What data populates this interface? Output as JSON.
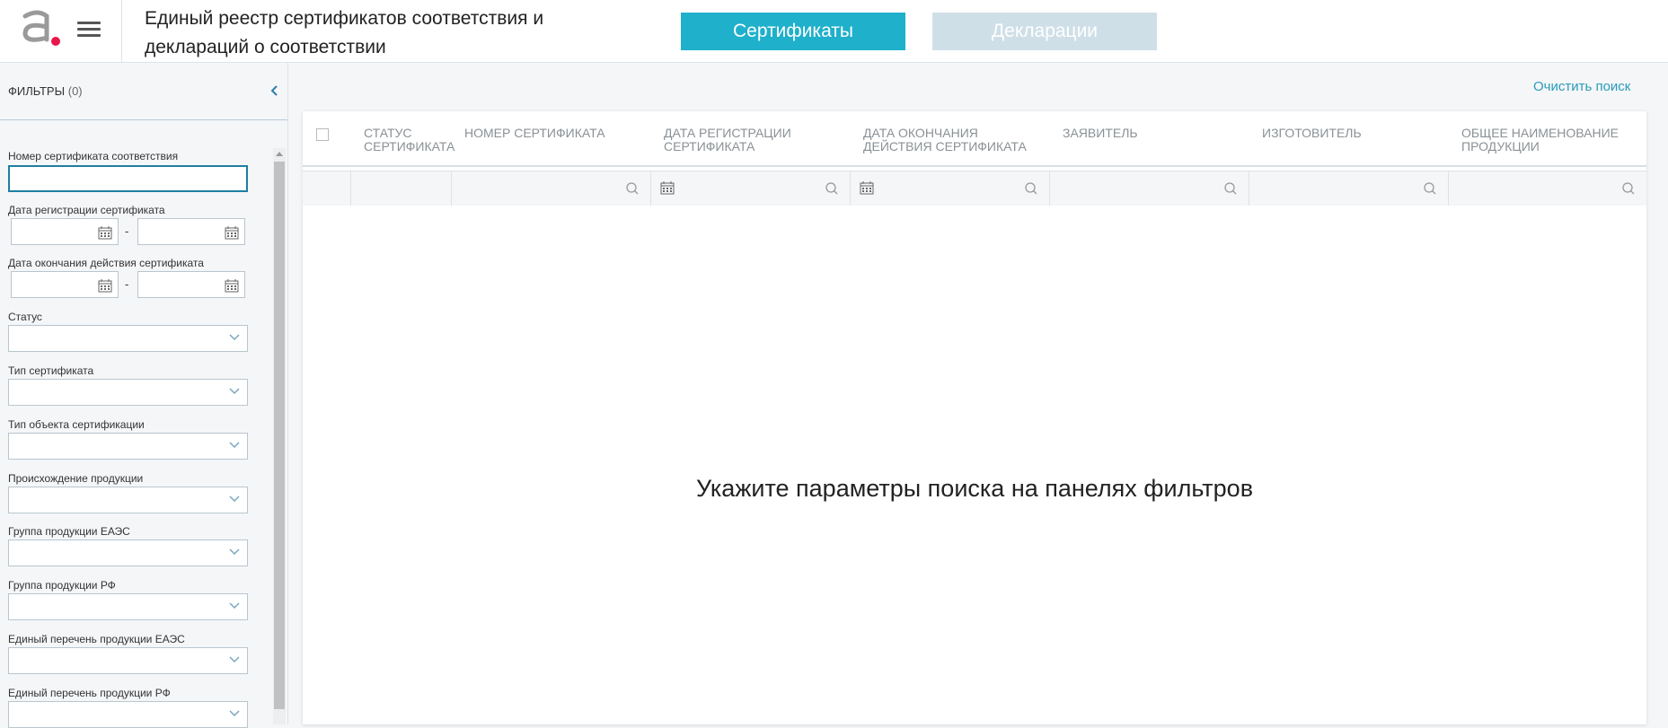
{
  "header": {
    "title": "Единый реестр сертификатов соответствия и деклараций о соответствии",
    "tabs": [
      {
        "label": "Сертификаты",
        "active": true
      },
      {
        "label": "Декларации",
        "active": false
      }
    ],
    "accent": "#1fb0cb",
    "logo_dot_color": "#e8174b"
  },
  "sidebar": {
    "title": "ФИЛЬТРЫ",
    "count": "(0)",
    "filters": [
      {
        "label": "Номер сертификата соответствия",
        "type": "text",
        "value": ""
      },
      {
        "label": "Дата регистрации сертификата",
        "type": "date-range",
        "separator": "-"
      },
      {
        "label": "Дата окончания действия сертификата",
        "type": "date-range",
        "separator": "-"
      },
      {
        "label": "Статус",
        "type": "select",
        "value": ""
      },
      {
        "label": "Тип сертификата",
        "type": "select",
        "value": ""
      },
      {
        "label": "Тип объекта сертификации",
        "type": "select",
        "value": ""
      },
      {
        "label": "Происхождение продукции",
        "type": "select",
        "value": ""
      },
      {
        "label": "Группа продукции ЕАЭС",
        "type": "select",
        "value": ""
      },
      {
        "label": "Группа продукции РФ",
        "type": "select",
        "value": ""
      },
      {
        "label": "Единый перечень продукции ЕАЭС",
        "type": "select",
        "value": ""
      },
      {
        "label": "Единый перечень продукции РФ",
        "type": "select",
        "value": ""
      }
    ]
  },
  "main": {
    "clear_search": "Очистить поиск",
    "columns": [
      "Статус сертификата",
      "Номер сертификата",
      "Дата регистрации сертификата",
      "Дата окончания действия сертификата",
      "Заявитель",
      "Изготовитель",
      "Общее наименование продукции"
    ],
    "empty_message": "Укажите параметры поиска на панелях фильтров"
  }
}
